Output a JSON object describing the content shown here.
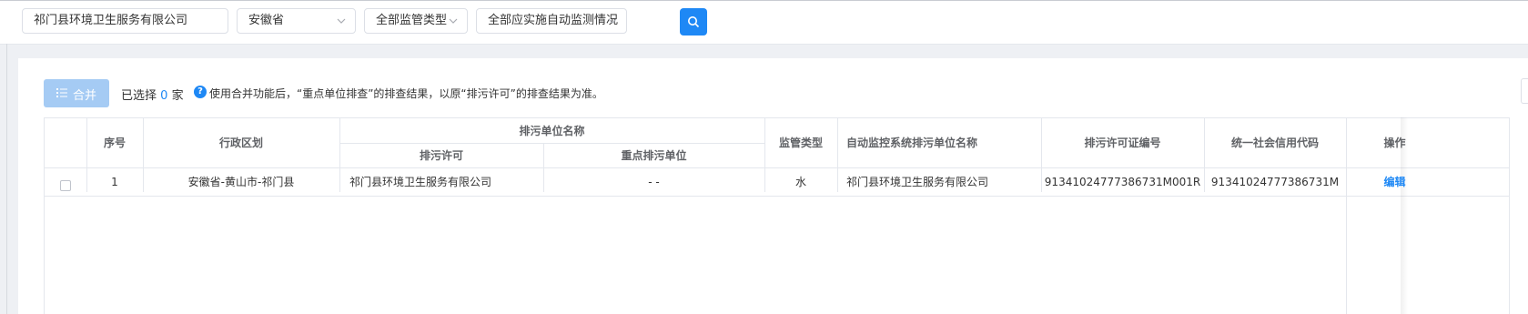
{
  "filters": {
    "company_value": "祁门县环境卫生服务有限公司",
    "province_value": "安徽省",
    "supervision_type_value": "全部监管类型",
    "monitoring_value": "全部应实施自动监测情况"
  },
  "toolbar": {
    "merge_label": "合并",
    "selected_prefix": "已选择",
    "selected_count": "0",
    "selected_suffix": "家",
    "notice": "使用合并功能后，“重点单位排查”的排查结果，以原“排污许可”的排查结果为准。"
  },
  "table": {
    "headers": {
      "index": "序号",
      "region": "行政区划",
      "unit_name_group": "排污单位名称",
      "permit": "排污许可",
      "key_unit": "重点排污单位",
      "supervision_type": "监管类型",
      "auto_monitor_name": "自动监控系统排污单位名称",
      "permit_no": "排污许可证编号",
      "credit_code": "统一社会信用代码",
      "actions": "操作"
    },
    "rows": [
      {
        "index": "1",
        "region": "安徽省-黄山市-祁门县",
        "permit": "祁门县环境卫生服务有限公司",
        "key_unit": "- -",
        "supervision_type": "水",
        "auto_monitor_name": "祁门县环境卫生服务有限公司",
        "permit_no": "91341024777386731M001R",
        "credit_code": "91341024777386731M",
        "action": "编辑"
      }
    ]
  },
  "colors": {
    "accent": "#1e88f5",
    "merge_disabled": "#a5cbf4",
    "header_bg": "#f5f7fa"
  }
}
